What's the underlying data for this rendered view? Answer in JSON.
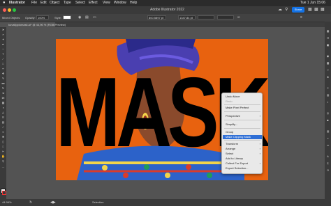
{
  "menubar": {
    "apple": "",
    "items": [
      "Illustrator",
      "File",
      "Edit",
      "Object",
      "Type",
      "Select",
      "Effect",
      "View",
      "Window",
      "Help"
    ],
    "clock": "Tue 1 Jun  15:06"
  },
  "titlebar": {
    "title": "Adobe Illustrator 2022",
    "share": "Share"
  },
  "controlbar": {
    "selection": "Mixed Objects",
    "opacity_label": "Opacity:",
    "opacity_value": "100%",
    "style_label": "Style:",
    "x_value": "800.5897 pt",
    "y_value": "1347.84 pt"
  },
  "doc": {
    "tab": "kuvatipplomask.ai* @ 44,96 % (RGB/Preview)"
  },
  "artwork": {
    "word": "MASK"
  },
  "context_menu": {
    "items": [
      {
        "label": "Undo Move",
        "state": "normal",
        "submenu": false
      },
      {
        "label": "Redo",
        "state": "disabled",
        "submenu": false
      },
      {
        "label": "Make Pixel Perfect",
        "state": "normal",
        "submenu": false
      },
      {
        "label": "Perspective",
        "state": "normal",
        "submenu": true
      },
      {
        "label": "Simplify...",
        "state": "normal",
        "submenu": false
      },
      {
        "label": "Group",
        "state": "normal",
        "submenu": false
      },
      {
        "label": "Make Clipping Mask",
        "state": "highlighted",
        "submenu": false
      },
      {
        "label": "Transform",
        "state": "normal",
        "submenu": true
      },
      {
        "label": "Arrange",
        "state": "normal",
        "submenu": true
      },
      {
        "label": "Select",
        "state": "normal",
        "submenu": true
      },
      {
        "label": "Add to Library",
        "state": "normal",
        "submenu": false
      },
      {
        "label": "Collect For Export",
        "state": "normal",
        "submenu": true
      },
      {
        "label": "Export Selection...",
        "state": "normal",
        "submenu": false
      }
    ]
  },
  "statusbar": {
    "zoom": "44.96%",
    "tool": "Selection"
  },
  "colors": {
    "artboard_bg": "#e8620f",
    "highlight": "#2f6fd6",
    "share_button": "#1473e6"
  }
}
